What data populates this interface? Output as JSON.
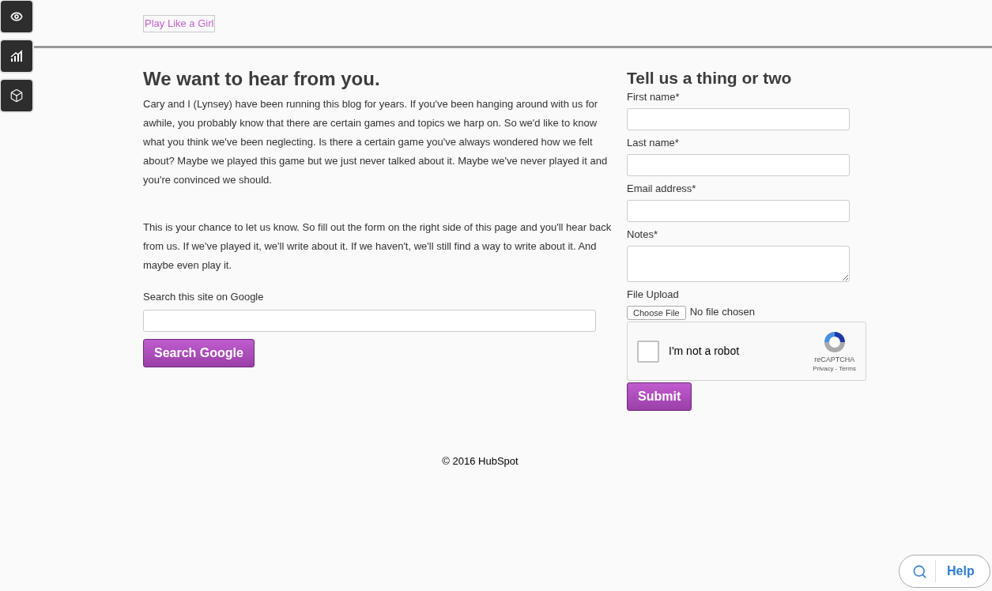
{
  "side_toolbar": {
    "buttons": [
      {
        "kind": "eye"
      },
      {
        "kind": "chart"
      },
      {
        "kind": "cube"
      }
    ]
  },
  "header": {
    "logo_alt": "Play Like a Girl"
  },
  "main": {
    "heading": "We want to hear from you.",
    "paragraphs": [
      "Cary and I (Lynsey) have been running this blog for years. If you've been hanging around with us for awhile, you probably know that there are certain games and topics we harp on. So we'd like to know what you think we've been neglecting. Is there a certain game you've always wondered how we felt about? Maybe we played this game but we just never talked about it. Maybe we've never played it and you're convinced we should.",
      "This is your chance to let us know. So fill out the form on the right side of this page and you'll hear back from us. If we've played it, we'll write about it. If we haven't, we'll still find a way to write about it. And maybe even play it."
    ],
    "search_label": "Search this site on Google",
    "search_button": "Search Google"
  },
  "form": {
    "heading": "Tell us a thing or two",
    "fields": [
      {
        "label": "First name*",
        "kind": "text"
      },
      {
        "label": "Last name*",
        "kind": "text"
      },
      {
        "label": "Email address*",
        "kind": "text"
      },
      {
        "label": "Notes*",
        "kind": "textarea"
      }
    ],
    "file_upload": {
      "label": "File Upload",
      "button": "Choose File",
      "status": "No file chosen"
    },
    "captcha": {
      "label": "I'm not a robot",
      "checked": false,
      "brand": "reCAPTCHA",
      "privacy": "Privacy",
      "separator": "-",
      "terms": "Terms"
    },
    "submit": "Submit"
  },
  "footer": {
    "copyright": "© 2016 HubSpot"
  },
  "help_widget": {
    "label": "Help"
  }
}
